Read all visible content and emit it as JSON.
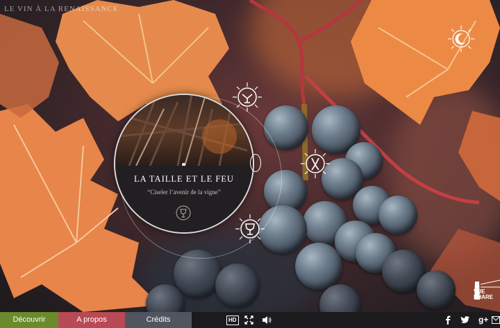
{
  "site": {
    "title": "LE VIN À LA RENAISSANCE"
  },
  "chapter": {
    "title": "LA TAILLE ET LE FEU",
    "subtitle": "“Ciseler l’avenir de la vigne”"
  },
  "bottom_tabs": [
    {
      "label": "Découvrir",
      "color": "#6b8a2c"
    },
    {
      "label": "A propos",
      "color": "#b84a55"
    },
    {
      "label": "Crédits",
      "color": "#505560"
    }
  ],
  "controls": {
    "hd_label": "HD"
  },
  "icons": {
    "night_mode": "moon-icon",
    "chapter_top": "grape-vine-icon",
    "chapter_middle": "pruning-shears-icon",
    "chapter_bottom": "wine-glass-icon",
    "fullscreen": "fullscreen-icon",
    "sound": "speaker-icon",
    "facebook": "facebook-icon",
    "twitter": "twitter-icon",
    "googleplus": "google-plus-icon",
    "email": "mail-icon"
  },
  "social": {
    "googleplus_label": "g+"
  },
  "brand": {
    "logo_text_line1": "VUE",
    "logo_text_line2": "PHARE"
  }
}
